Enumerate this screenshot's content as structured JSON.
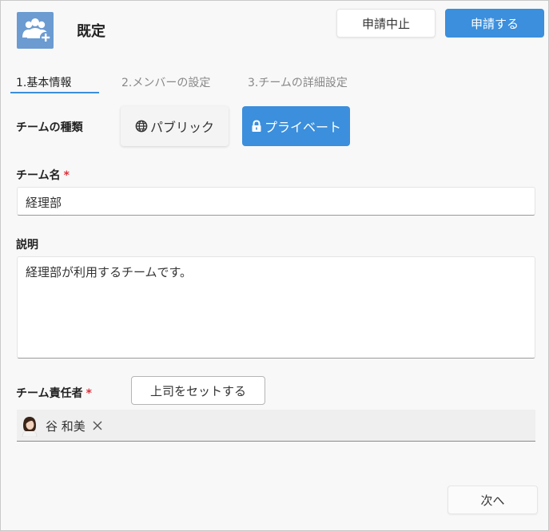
{
  "header": {
    "title": "既定",
    "cancel_request_label": "申請中止",
    "submit_request_label": "申請する"
  },
  "tabs": [
    {
      "label": "1.基本情報",
      "active": true
    },
    {
      "label": "2.メンバーの設定",
      "active": false
    },
    {
      "label": "3.チームの詳細設定",
      "active": false
    }
  ],
  "form": {
    "team_type_label": "チームの種類",
    "public_label": "パブリック",
    "private_label": "プライベート",
    "selected_type": "プライベート",
    "team_name_label": "チーム名",
    "required_mark": "*",
    "team_name_value": "経理部",
    "description_label": "説明",
    "description_value": "経理部が利用するチームです。",
    "owner_label": "チーム責任者",
    "set_boss_label": "上司をセットする",
    "owners": [
      {
        "name": "谷 和美"
      }
    ]
  },
  "footer": {
    "next_label": "次へ"
  },
  "colors": {
    "accent": "#3b8fdc",
    "icon_bg": "#6b9bd0",
    "required": "#e0303a"
  },
  "icons": [
    "team-add-icon",
    "globe-icon",
    "lock-icon",
    "remove-icon"
  ]
}
